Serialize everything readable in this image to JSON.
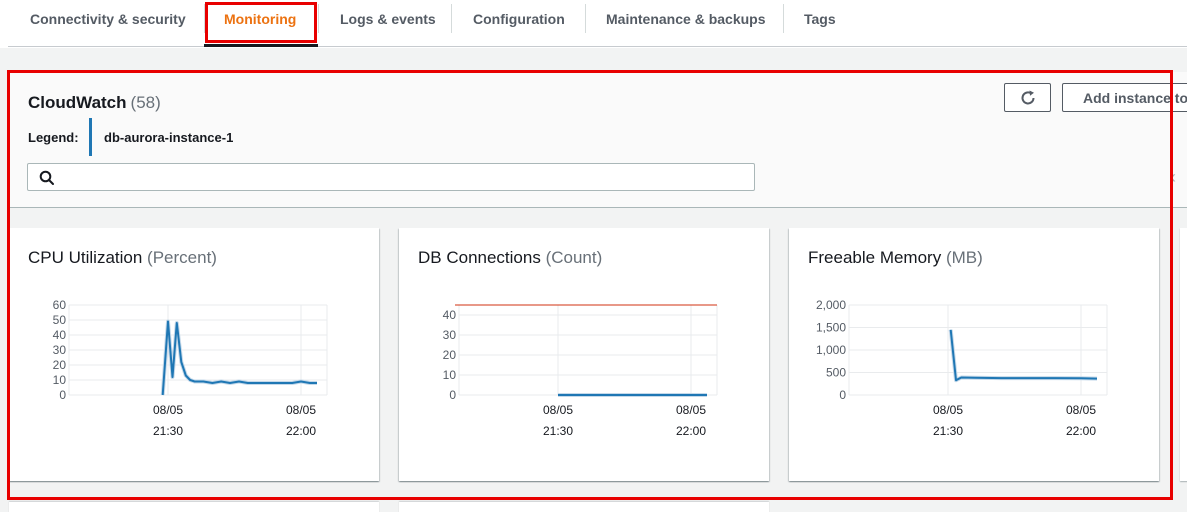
{
  "tabs": [
    {
      "label": "Connectivity & security",
      "active": false
    },
    {
      "label": "Monitoring",
      "active": true
    },
    {
      "label": "Logs & events",
      "active": false
    },
    {
      "label": "Configuration",
      "active": false
    },
    {
      "label": "Maintenance & backups",
      "active": false
    },
    {
      "label": "Tags",
      "active": false
    }
  ],
  "cloudwatch": {
    "title": "CloudWatch",
    "count": "(58)",
    "legend_label": "Legend:",
    "legend_value": "db-aurora-instance-1",
    "legend_color": "#1f77b4",
    "search_placeholder": "",
    "refresh_icon": "refresh-icon",
    "add_button_label": "Add instance to compare"
  },
  "colors": {
    "active_tab": "#ec7211",
    "series_line": "#1f77b4",
    "threshold_line": "#d13212",
    "annotation_box": "#e80000"
  },
  "chart_data": [
    {
      "type": "line",
      "title": "CPU Utilization",
      "unit": "(Percent)",
      "ylim": [
        0,
        60
      ],
      "yticks": [
        "60",
        "50",
        "40",
        "30",
        "20",
        "10",
        "0"
      ],
      "xticks": [
        {
          "date": "08/05",
          "time": "21:30"
        },
        {
          "date": "08/05",
          "time": "22:00"
        }
      ],
      "x_range_min": [
        21.0,
        22.25
      ],
      "series": [
        {
          "x": [
            21.48,
            21.5,
            21.517,
            21.533,
            21.55,
            21.567,
            21.583,
            21.6,
            21.633,
            21.667,
            21.7,
            21.733,
            21.767,
            21.8,
            21.833,
            21.867,
            21.9,
            21.933,
            21.967,
            22.0,
            22.033,
            22.06
          ],
          "y": [
            0,
            49,
            12,
            48,
            22,
            13,
            10,
            9,
            9,
            8,
            9,
            8,
            9,
            8,
            8,
            8,
            8,
            8,
            8,
            9,
            8,
            8
          ]
        }
      ],
      "grid": true
    },
    {
      "type": "line",
      "title": "DB Connections",
      "unit": "(Count)",
      "ylim": [
        0,
        45
      ],
      "yticks": [
        "40",
        "30",
        "20",
        "10",
        "0"
      ],
      "xticks": [
        {
          "date": "08/05",
          "time": "21:30"
        },
        {
          "date": "08/05",
          "time": "22:00"
        }
      ],
      "threshold": 45,
      "series": [
        {
          "x": [
            21.5,
            22.06
          ],
          "y": [
            0,
            0
          ]
        }
      ],
      "grid": true
    },
    {
      "type": "line",
      "title": "Freeable Memory",
      "unit": "(MB)",
      "ylim": [
        0,
        2000
      ],
      "yticks": [
        "2,000",
        "1,500",
        "1,000",
        "500",
        "0"
      ],
      "xticks": [
        {
          "date": "08/05",
          "time": "21:30"
        },
        {
          "date": "08/05",
          "time": "22:00"
        }
      ],
      "series": [
        {
          "x": [
            21.51,
            21.53,
            21.55,
            21.6,
            21.7,
            21.8,
            21.9,
            22.0,
            22.06
          ],
          "y": [
            1450,
            330,
            390,
            385,
            375,
            375,
            375,
            370,
            365
          ]
        }
      ],
      "grid": true
    }
  ]
}
